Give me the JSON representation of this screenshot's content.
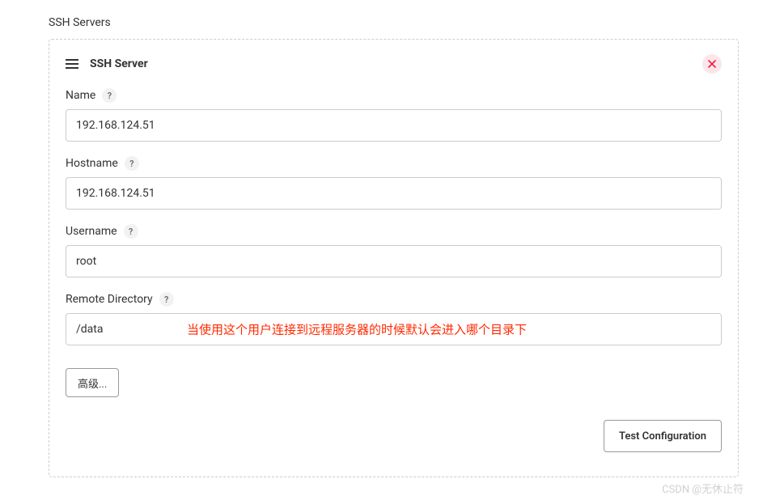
{
  "page": {
    "title": "SSH Servers"
  },
  "panel": {
    "title": "SSH Server"
  },
  "fields": {
    "name": {
      "label": "Name",
      "help": "?",
      "value": "192.168.124.51"
    },
    "hostname": {
      "label": "Hostname",
      "help": "?",
      "value": "192.168.124.51"
    },
    "username": {
      "label": "Username",
      "help": "?",
      "value": "root"
    },
    "remoteDir": {
      "label": "Remote Directory",
      "help": "?",
      "value": "/data",
      "annotation": "当使用这个用户连接到远程服务器的时候默认会进入哪个目录下"
    }
  },
  "buttons": {
    "advanced": "高级...",
    "testConfig": "Test Configuration"
  },
  "watermark": "CSDN @无休止符"
}
